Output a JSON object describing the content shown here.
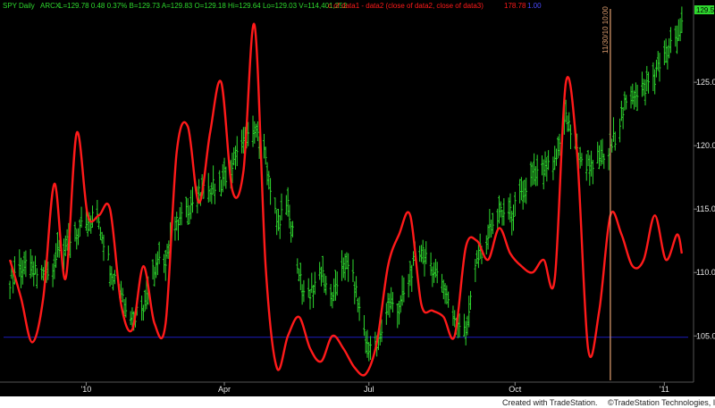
{
  "header": {
    "symbol": "SPY",
    "interval": "Daily",
    "exchange": "ARCX",
    "quote_text": "L=129.78  0.48  0.37%  B=129.73  A=129.83  O=129.18  Hi=129.64  Lo=129.03  V=114,401,252",
    "formula_text": "c of data1 - data2 (close of data2, close of data3)",
    "red_series_value": "178.78",
    "blue_series_value": "1.00"
  },
  "price_tag": "129.53",
  "vertical_marker_label": "11/30/10 10:00",
  "footer": {
    "credit_left": "Created with TradeStation.",
    "credit_right": "©TradeStation Technologies, Inc."
  },
  "colors": {
    "background": "#000000",
    "price_bars": "#2ed82e",
    "oscillator": "#ff1a1a",
    "baseline": "#1a1aa8",
    "marker": "#e0a070",
    "footer_bg": "#ffffff",
    "price_tag_bg": "#2ed82e"
  },
  "chart_data": {
    "type": "line",
    "title": "",
    "xlabel": "",
    "ylabel": "",
    "x_tick_labels": [
      "'10",
      "Apr",
      "Jul",
      "Oct",
      "'11"
    ],
    "y_ticks": [
      105.0,
      110.0,
      115.0,
      120.0,
      125.0
    ],
    "y_tick_labels": [
      "105.00",
      "110.00",
      "115.00",
      "120.00",
      "125.00"
    ],
    "ylim": [
      101.5,
      130.5
    ],
    "grid": false,
    "legend": "none",
    "dates": [
      "2009-11-17",
      "2009-11-24",
      "2009-12-01",
      "2009-12-08",
      "2009-12-15",
      "2009-12-22",
      "2009-12-29",
      "2010-01-05",
      "2010-01-12",
      "2010-01-19",
      "2010-01-26",
      "2010-02-02",
      "2010-02-09",
      "2010-02-16",
      "2010-02-23",
      "2010-03-02",
      "2010-03-09",
      "2010-03-16",
      "2010-03-23",
      "2010-03-30",
      "2010-04-06",
      "2010-04-13",
      "2010-04-20",
      "2010-04-27",
      "2010-05-04",
      "2010-05-11",
      "2010-05-18",
      "2010-05-25",
      "2010-06-01",
      "2010-06-08",
      "2010-06-15",
      "2010-06-22",
      "2010-06-29",
      "2010-07-06",
      "2010-07-13",
      "2010-07-20",
      "2010-07-27",
      "2010-08-03",
      "2010-08-10",
      "2010-08-17",
      "2010-08-24",
      "2010-08-31",
      "2010-09-07",
      "2010-09-14",
      "2010-09-21",
      "2010-09-28",
      "2010-10-05",
      "2010-10-12",
      "2010-10-19",
      "2010-10-26",
      "2010-11-02",
      "2010-11-09",
      "2010-11-16",
      "2010-11-23",
      "2010-11-30",
      "2010-12-07",
      "2010-12-14",
      "2010-12-21",
      "2010-12-28",
      "2011-01-04",
      "2011-01-11",
      "2011-01-14"
    ],
    "series": [
      {
        "name": "SPY",
        "style": "ohlc-bars",
        "values": [
          109.5,
          110.5,
          110.0,
          109.8,
          111.0,
          112.0,
          113.0,
          114.5,
          114.0,
          110.5,
          108.5,
          106.5,
          107.5,
          110.5,
          111.2,
          113.8,
          115.2,
          116.0,
          116.5,
          117.2,
          118.3,
          120.0,
          121.0,
          119.0,
          114.0,
          115.5,
          109.5,
          108.5,
          110.0,
          108.0,
          111.0,
          109.0,
          104.5,
          104.0,
          107.5,
          107.0,
          110.0,
          112.0,
          110.5,
          109.0,
          106.5,
          105.5,
          111.0,
          113.0,
          114.5,
          114.5,
          116.0,
          117.5,
          118.0,
          118.5,
          122.3,
          119.5,
          118.5,
          119.0,
          119.5,
          122.5,
          124.2,
          124.5,
          125.5,
          127.2,
          128.5,
          129.5
        ]
      },
      {
        "name": "",
        "style": "line",
        "values": [
          111.0,
          108.0,
          104.5,
          108.0,
          117.0,
          109.5,
          121.0,
          114.5,
          114.5,
          115.0,
          107.5,
          105.5,
          110.5,
          106.0,
          106.0,
          119.5,
          121.5,
          115.5,
          121.0,
          125.0,
          116.5,
          118.0,
          129.5,
          110.5,
          102.5,
          105.0,
          106.5,
          104.0,
          103.0,
          105.0,
          104.0,
          102.5,
          102.0,
          104.5,
          110.5,
          113.0,
          114.5,
          107.5,
          107.0,
          106.5,
          105.0,
          112.0,
          112.5,
          111.0,
          113.5,
          111.5,
          110.5,
          110.0,
          111.0,
          109.5,
          125.0,
          119.5,
          104.0,
          107.0,
          114.5,
          113.0,
          110.5,
          111.0,
          114.5,
          111.0,
          113.0,
          111.5
        ]
      },
      {
        "name": "",
        "style": "horizontal",
        "values": [
          104.9
        ]
      }
    ],
    "vertical_marker_date": "2010-11-30"
  }
}
